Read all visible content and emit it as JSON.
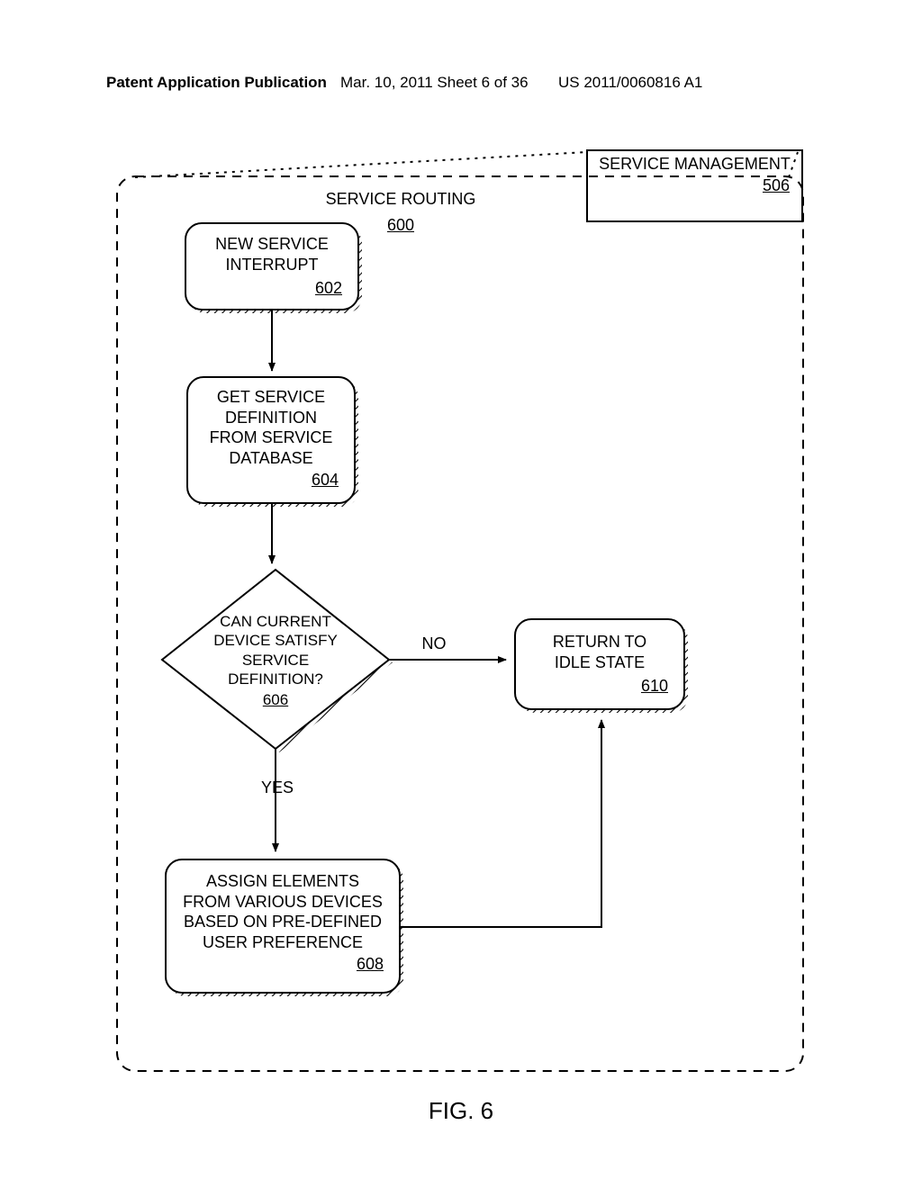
{
  "header": {
    "left": "Patent Application Publication",
    "mid": "Mar. 10, 2011  Sheet 6 of 36",
    "right": "US 2011/0060816 A1"
  },
  "title": {
    "label": "SERVICE ROUTING",
    "ref": "600"
  },
  "mgmt": {
    "label": "SERVICE MANAGEMENT",
    "ref": "506"
  },
  "box602": {
    "label": "NEW SERVICE INTERRUPT",
    "ref": "602"
  },
  "box604": {
    "label": "GET SERVICE DEFINITION FROM SERVICE DATABASE",
    "ref": "604"
  },
  "dec606": {
    "label": "CAN CURRENT DEVICE SATISFY SERVICE DEFINITION?",
    "ref": "606"
  },
  "box608": {
    "label": "ASSIGN ELEMENTS FROM VARIOUS DEVICES BASED ON PRE-DEFINED USER PREFERENCE",
    "ref": "608"
  },
  "box610": {
    "label": "RETURN TO IDLE STATE",
    "ref": "610"
  },
  "labels": {
    "no": "NO",
    "yes": "YES"
  },
  "figure": "FIG. 6"
}
